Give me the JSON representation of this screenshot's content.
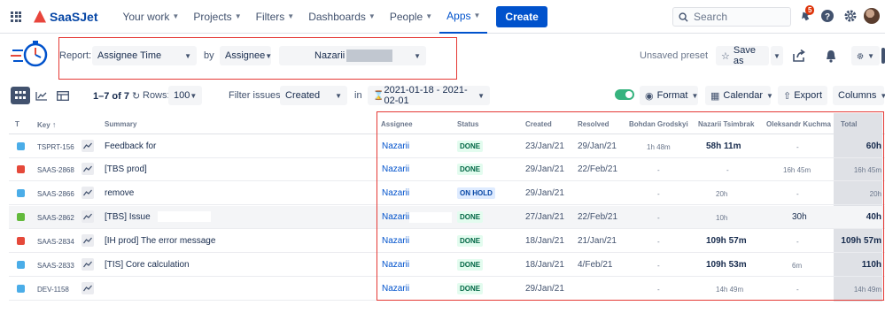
{
  "nav": {
    "brand": "SaaSJet",
    "items": [
      "Your work",
      "Projects",
      "Filters",
      "Dashboards",
      "People",
      "Apps"
    ],
    "active": "Apps",
    "create": "Create",
    "search_placeholder": "Search",
    "notif_count": "5"
  },
  "report": {
    "report_label": "Report:",
    "report_value": "Assignee Time",
    "by_label": "by",
    "by_value": "Assignee",
    "person_value": "Nazarii",
    "unsaved": "Unsaved preset",
    "save_as": "Save as"
  },
  "toolbar": {
    "count_text": "1–7 of 7",
    "rows_label": "Rows:",
    "rows_value": "100",
    "filter_label": "Filter issues:",
    "filter_value": "Created",
    "in_label": "in",
    "date_range": "2021-01-18 - 2021-02-01",
    "format": "Format",
    "calendar": "Calendar",
    "export": "Export",
    "columns": "Columns"
  },
  "table": {
    "headers": {
      "t": "T",
      "key": "Key",
      "summary": "Summary",
      "assignee": "Assignee",
      "status": "Status",
      "created": "Created",
      "resolved": "Resolved",
      "u1": "Bohdan Grodskyi",
      "u2": "Nazarii Tsimbrak",
      "u3": "Oleksandr Kuchma",
      "total": "Total"
    },
    "rows": [
      {
        "type": "task",
        "key": "TSPRT-156",
        "summary": "Feedback for",
        "assignee": "Nazarii",
        "status": "DONE",
        "created": "23/Jan/21",
        "resolved": "29/Jan/21",
        "u1": "1h 48m",
        "u2": "58h 11m",
        "u3": "-",
        "total": "60h"
      },
      {
        "type": "bug",
        "key": "SAAS-2868",
        "summary": "[TBS prod]",
        "assignee": "Nazarii",
        "status": "DONE",
        "created": "29/Jan/21",
        "resolved": "22/Feb/21",
        "u1": "-",
        "u2": "-",
        "u3": "16h 45m",
        "total": "16h 45m"
      },
      {
        "type": "task",
        "key": "SAAS-2866",
        "summary": "remove",
        "assignee": "Nazarii",
        "status": "ON HOLD",
        "created": "29/Jan/21",
        "resolved": "",
        "u1": "-",
        "u2": "20h",
        "u3": "-",
        "total": "20h"
      },
      {
        "type": "story",
        "key": "SAAS-2862",
        "summary": "[TBS] Issue",
        "assignee": "Nazarii",
        "status": "DONE",
        "created": "27/Jan/21",
        "resolved": "22/Feb/21",
        "u1": "-",
        "u2": "10h",
        "u3": "30h",
        "total": "40h"
      },
      {
        "type": "bug",
        "key": "SAAS-2834",
        "summary": "[IH prod] The error message",
        "assignee": "Nazarii",
        "status": "DONE",
        "created": "18/Jan/21",
        "resolved": "21/Jan/21",
        "u1": "-",
        "u2": "109h 57m",
        "u3": "-",
        "total": "109h 57m"
      },
      {
        "type": "task",
        "key": "SAAS-2833",
        "summary": "[TIS] Core calculation",
        "assignee": "Nazarii",
        "status": "DONE",
        "created": "18/Jan/21",
        "resolved": "4/Feb/21",
        "u1": "-",
        "u2": "109h 53m",
        "u3": "6m",
        "total": "110h"
      },
      {
        "type": "task",
        "key": "DEV-1158",
        "summary": "",
        "assignee": "Nazarii",
        "status": "DONE",
        "created": "29/Jan/21",
        "resolved": "",
        "u1": "-",
        "u2": "14h 49m",
        "u3": "-",
        "total": "14h 49m"
      }
    ]
  },
  "colors": {
    "accent": "#0052cc",
    "highlight_box": "#e53935",
    "done_bg": "#e3fcef",
    "hold_bg": "#deebff",
    "bug": "#e5493a",
    "task": "#4bade8",
    "story": "#63ba3c"
  }
}
